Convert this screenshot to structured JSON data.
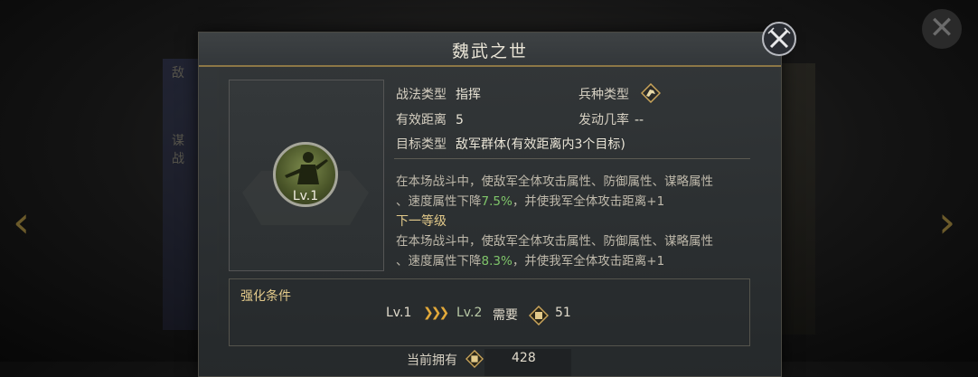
{
  "background": {
    "left_panel_text": [
      "敌",
      "谋",
      "战"
    ]
  },
  "dialog": {
    "title": "魏武之世",
    "portrait": {
      "level": "Lv.1"
    },
    "info": {
      "tactic_type_label": "战法类型",
      "tactic_type_value": "指挥",
      "troop_type_label": "兵种类型",
      "range_label": "有效距离",
      "range_value": "5",
      "trigger_rate_label": "发动几率",
      "trigger_rate_value": "--",
      "target_type_label": "目标类型",
      "target_type_value": "敌军群体(有效距离内3个目标)"
    },
    "description": {
      "current_line1": "在本场战斗中，使敌军全体攻击属性、防御属性、谋略属性",
      "current_line2_pre": "、速度属性下降",
      "current_value": "7.5%",
      "current_line2_post": "，并使我军全体攻击距离+1",
      "next_level_title": "下一等级",
      "next_line1": "在本场战斗中，使敌军全体攻击属性、防御属性、谋略属性",
      "next_line2_pre": "、速度属性下降",
      "next_value": "8.3%",
      "next_line2_post": "，并使我军全体攻击距离+1"
    },
    "upgrade": {
      "title": "强化条件",
      "from_level": "Lv.1",
      "to_level": "Lv.2",
      "need_label": "需要",
      "need_amount": "51"
    },
    "owned": {
      "label": "当前拥有",
      "amount": "428"
    }
  },
  "colors": {
    "accent_gold": "#e2c98a",
    "highlight_green": "#7fc56a",
    "chevron_orange": "#e2a93a"
  },
  "icons": [
    "close-icon",
    "troop-type-icon",
    "resource-icon",
    "chevron-arrows-icon"
  ]
}
